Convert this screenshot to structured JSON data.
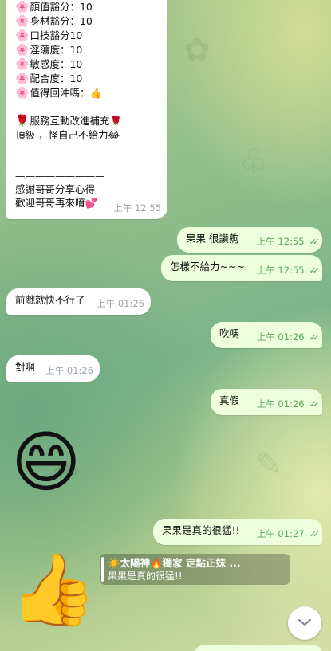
{
  "messages": {
    "m1": {
      "lines": [
        {
          "icon": "🌸",
          "text": "顏值豁分：10"
        },
        {
          "icon": "🌸",
          "text": "身材豁分：10"
        },
        {
          "icon": "🌸",
          "text": "口技豁分10"
        },
        {
          "icon": "🌸",
          "text": "淫蕩度：10"
        },
        {
          "icon": "🌸",
          "text": "敏感度：10"
        },
        {
          "icon": "🌸",
          "text": "配合度：10"
        },
        {
          "icon": "🌸",
          "text": "值得回沖嗎：👍"
        },
        {
          "icon": "",
          "text": "—————————"
        },
        {
          "icon": "🌹",
          "text": "服務互動改進補充🌹"
        },
        {
          "icon": "",
          "text": "頂級 ，怪自己不給力😂"
        },
        {
          "icon": "",
          "text": ""
        },
        {
          "icon": "",
          "text": ""
        },
        {
          "icon": "",
          "text": "—————————"
        },
        {
          "icon": "",
          "text": "感謝哥哥分享心得"
        },
        {
          "icon": "",
          "text": "歡迎哥哥再來唷💕"
        }
      ],
      "time": "上午 12:55"
    },
    "m2": {
      "text": "果果 很讚齁",
      "time": "上午 12:55",
      "status": "✓✓"
    },
    "m3": {
      "text": "怎樣不給力~~~",
      "time": "上午 12:55",
      "status": "✓✓"
    },
    "m4": {
      "text": "前戲就快不行了",
      "time": "上午 01:26"
    },
    "m5": {
      "text": "吹嗎",
      "time": "上午 01:26",
      "status": "✓✓"
    },
    "m6": {
      "text": "對啊",
      "time": "上午 01:26"
    },
    "m7": {
      "text": "真假",
      "time": "上午 01:26",
      "status": "✓✓"
    },
    "sticker1": {
      "emoji": "😄"
    },
    "m8": {
      "text": "果果是真的很猛!!",
      "time": "上午 01:27",
      "status": "✓✓"
    },
    "reply": {
      "title": "☀️太陽神🔥獨家 定點正妹 ...",
      "text": "果果是真的很猛!!"
    },
    "sticker2": {
      "emoji": "👍"
    }
  },
  "icons": {
    "scroll_down": "chevron-down-icon",
    "read_status": "double-check-icon"
  },
  "colors": {
    "incoming_bubble": "#ffffff",
    "outgoing_bubble": "#eeffde",
    "outgoing_meta": "#5ea85a",
    "incoming_meta": "#9aa3ad"
  }
}
